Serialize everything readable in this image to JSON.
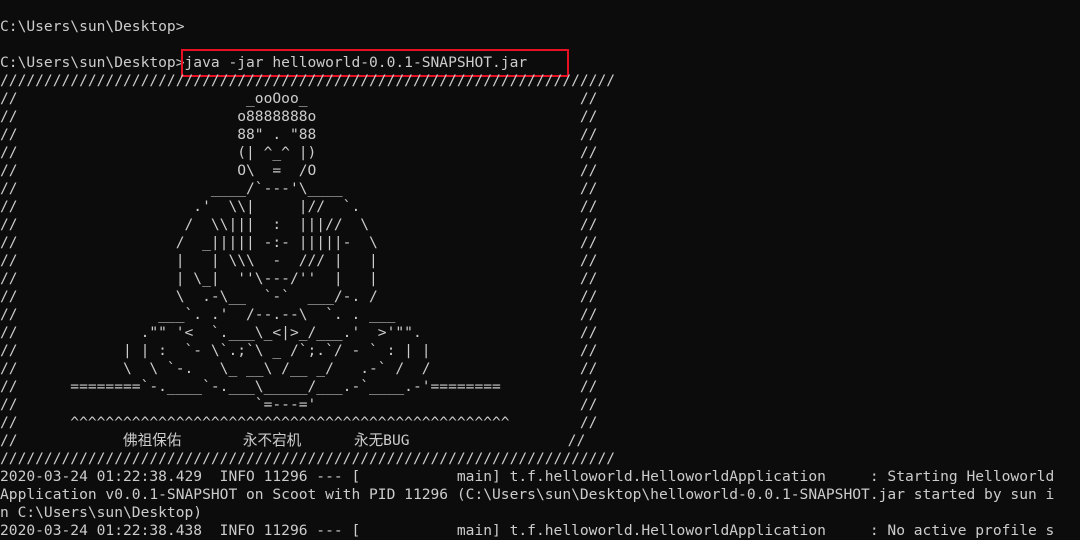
{
  "terminal": {
    "prompt_line_1": "C:\\Users\\sun\\Desktop>",
    "prompt_line_2": "C:\\Users\\sun\\Desktop>java -jar helloworld-0.0.1-SNAPSHOT.jar",
    "command": "java -jar helloworld-0.0.1-SNAPSHOT.jar",
    "banner": [
      "//////////////////////////////////////////////////////////////////////",
      "//                          _ooOoo_                               //",
      "//                         o8888888o                              //",
      "//                         88\" . \"88                              //",
      "//                         (| ^_^ |)                              //",
      "//                         O\\  =  /O                              //",
      "//                      ____/`---'\\____                           //",
      "//                    .'  \\\\|     |//  `.                         //",
      "//                   /  \\\\|||  :  |||//  \\                        //",
      "//                  /  _||||| -:- |||||-  \\                       //",
      "//                  |   | \\\\\\  -  /// |   |                       //",
      "//                  | \\_|  ''\\---/''  |   |                       //",
      "//                  \\  .-\\__  `-`  ___/-. /                       //",
      "//                ___`. .'  /--.--\\  `. . ___                     //",
      "//              .\"\" '<  `.___\\_<|>_/___.'  >'\"\".                  //",
      "//            | | :  `- \\`.;`\\ _ /`;.`/ - ` : | |                 //",
      "//            \\  \\ `-.   \\_ __\\ /__ _/   .-` /  /                 //",
      "//      ========`-.____`-.___\\_____/___.-`____.-'========         //",
      "//                           `=---='                              //",
      "//      ^^^^^^^^^^^^^^^^^^^^^^^^^^^^^^^^^^^^^^^^^^^^^^^^^^        //",
      "//            佛祖保佑       永不宕机      永无BUG                  //",
      "//////////////////////////////////////////////////////////////////////"
    ],
    "log_lines": [
      "2020-03-24 01:22:38.429  INFO 11296 --- [           main] t.f.helloworld.HelloworldApplication     : Starting Helloworld",
      "Application v0.0.1-SNAPSHOT on Scoot with PID 11296 (C:\\Users\\sun\\Desktop\\helloworld-0.0.1-SNAPSHOT.jar started by sun i",
      "n C:\\Users\\sun\\Desktop)",
      "2020-03-24 01:22:38.438  INFO 11296 --- [           main] t.f.helloworld.HelloworldApplication     : No active profile s"
    ]
  },
  "colors": {
    "background": "#0c0c0c",
    "foreground": "#cccccc",
    "highlight": "#e81123"
  }
}
